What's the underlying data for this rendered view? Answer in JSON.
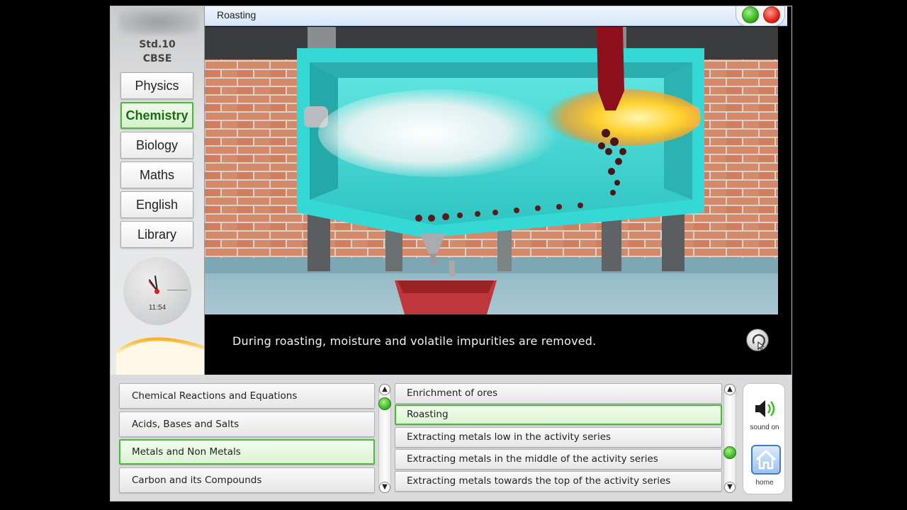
{
  "window": {
    "title": "Roasting"
  },
  "sidebar": {
    "standard": "Std.10",
    "board": "CBSE",
    "subjects": [
      "Physics",
      "Chemistry",
      "Biology",
      "Maths",
      "English",
      "Library"
    ],
    "active_subject": "Chemistry",
    "clock_time": "11:54"
  },
  "player": {
    "caption": "During roasting, moisture and volatile impurities are removed."
  },
  "chapters": {
    "items": [
      "Chemical Reactions and Equations",
      "Acids, Bases and Salts",
      "Metals and Non Metals",
      "Carbon and its Compounds"
    ],
    "active": "Metals and Non Metals"
  },
  "topics": {
    "items": [
      "Enrichment of ores",
      "Roasting",
      "Extracting metals low in the activity series",
      "Extracting metals in the middle of the activity series",
      "Extracting metals towards the top of the activity series"
    ],
    "active": "Roasting"
  },
  "controls": {
    "sound_label": "sound on",
    "home_label": "home"
  },
  "icons": [
    "speaker-icon",
    "home-icon",
    "replay-icon",
    "scroll-up-icon",
    "scroll-down-icon"
  ],
  "colors": {
    "accent": "#4cb93c",
    "furnace": "#35d3d0",
    "hopper": "#c0363b"
  }
}
